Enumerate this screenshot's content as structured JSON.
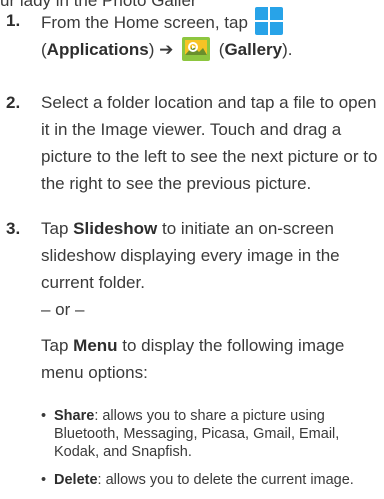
{
  "top_fragment": "ur lady in the Photo Galler",
  "steps": [
    {
      "number": "1.",
      "prefix": "From the Home screen, tap",
      "applications_label": "Applications",
      "arrow": "➔",
      "gallery_label": "Gallery",
      "suffix": "."
    },
    {
      "number": "2.",
      "text": "Select a folder location and tap a file to open it in the Image viewer. Touch and drag a picture to the left to see the next picture or to the right to see the previous picture."
    },
    {
      "number": "3.",
      "tap1": "Tap",
      "slideshow_label": "Slideshow",
      "slideshow_text": "to initiate an on-screen slideshow displaying every image in the current folder.",
      "or_text": "– or –",
      "tap2": "Tap",
      "menu_label": "Menu",
      "menu_text": "to display the following image menu options:"
    }
  ],
  "bullets": [
    {
      "term": "Share",
      "desc": ": allows you to share a picture using Bluetooth, Messaging, Picasa, Gmail, Email, Kodak, and Snapfish."
    },
    {
      "term": "Delete",
      "desc": ": allows you to delete the current image."
    }
  ],
  "colors": {
    "applications_icon": "#28a3e8",
    "gallery_icon_frame": "#8dc63f",
    "gallery_icon_photo": "#f7c325"
  }
}
